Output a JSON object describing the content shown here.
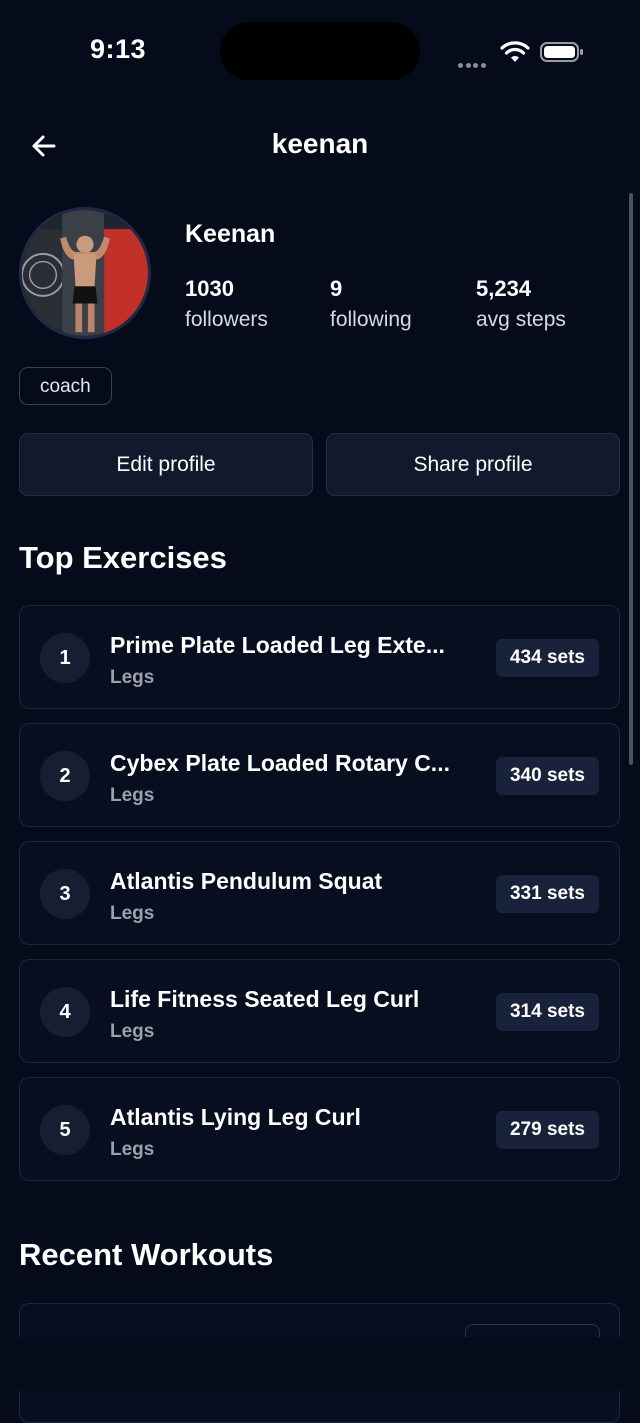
{
  "status_bar": {
    "time": "9:13"
  },
  "header": {
    "title": "keenan"
  },
  "profile": {
    "name": "Keenan",
    "stats": [
      {
        "value": "1030",
        "label": "followers"
      },
      {
        "value": "9",
        "label": "following"
      },
      {
        "value": "5,234",
        "label": "avg steps"
      }
    ],
    "tag": "coach"
  },
  "actions": {
    "edit_label": "Edit profile",
    "share_label": "Share profile"
  },
  "top_exercises": {
    "title": "Top Exercises",
    "items": [
      {
        "rank": "1",
        "name": "Prime Plate Loaded Leg Exte...",
        "category": "Legs",
        "sets": "434 sets"
      },
      {
        "rank": "2",
        "name": "Cybex Plate Loaded Rotary C...",
        "category": "Legs",
        "sets": "340 sets"
      },
      {
        "rank": "3",
        "name": "Atlantis Pendulum Squat",
        "category": "Legs",
        "sets": "331 sets"
      },
      {
        "rank": "4",
        "name": "Life Fitness Seated Leg Curl",
        "category": "Legs",
        "sets": "314 sets"
      },
      {
        "rank": "5",
        "name": "Atlantis Lying Leg Curl",
        "category": "Legs",
        "sets": "279 sets"
      }
    ]
  },
  "recent_workouts": {
    "title": "Recent Workouts"
  },
  "icons": {
    "back": "arrow-left-icon",
    "wifi": "wifi-icon",
    "battery": "battery-icon"
  }
}
